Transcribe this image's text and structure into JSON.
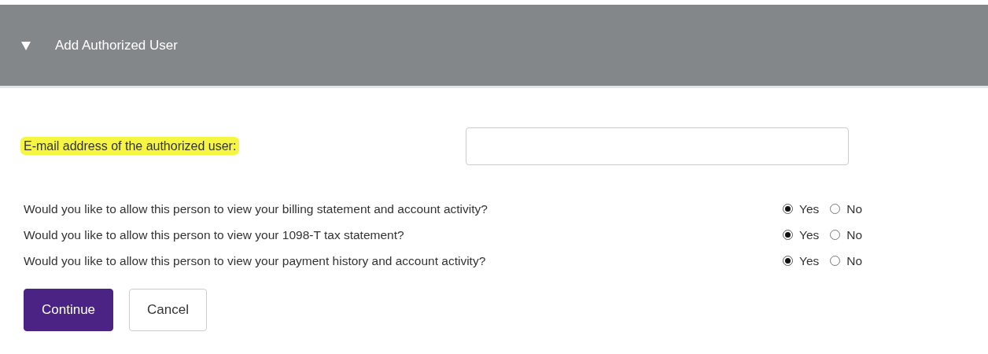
{
  "panel": {
    "expanded": true,
    "title": "Add Authorized User"
  },
  "email": {
    "label": "E-mail address of the authorized user:",
    "highlighted": true
  },
  "questions": [
    {
      "text": "Would you like to allow this person to view your billing statement and account activity?",
      "options": [
        {
          "label": "Yes",
          "selected": true
        },
        {
          "label": "No",
          "selected": false
        }
      ]
    },
    {
      "text": "Would you like to allow this person to view your 1098-T tax statement?",
      "options": [
        {
          "label": "Yes",
          "selected": true
        },
        {
          "label": "No",
          "selected": false
        }
      ]
    },
    {
      "text": "Would you like to allow this person to view your payment history and account activity?",
      "options": [
        {
          "label": "Yes",
          "selected": true
        },
        {
          "label": "No",
          "selected": false
        }
      ]
    }
  ],
  "buttons": [
    {
      "label": "Continue",
      "kind": "primary"
    },
    {
      "label": "Cancel",
      "kind": "secondary"
    }
  ]
}
